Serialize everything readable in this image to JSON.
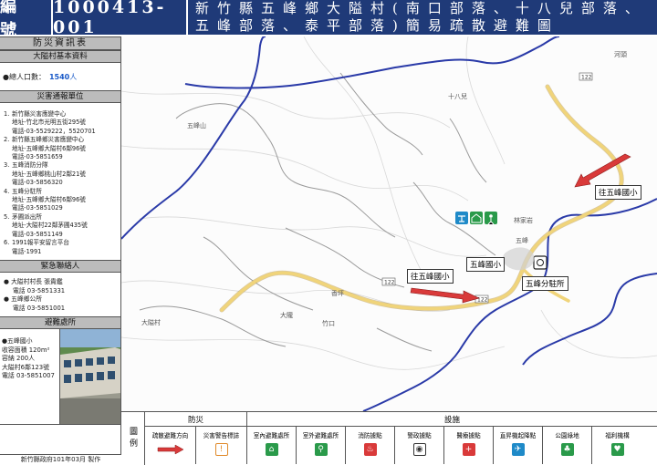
{
  "header": {
    "label": "編 號",
    "code": "1000413-001",
    "title_line1": "新竹縣五峰鄉大隘村(南口部落、十八兒部落、",
    "title_line2": "五峰部落、泰平部落)簡易疏散避難圖"
  },
  "sidebar": {
    "main_title": "防災資訊表",
    "basic_title": "大隘村基本資料",
    "pop_label": "●總人口數：",
    "pop_value": "1540",
    "pop_unit": "人",
    "units_title": "災害通報單位",
    "units": [
      {
        "num": "1.",
        "lines": [
          "新竹縣災害應變中心",
          "地址-竹北市光明五街295號",
          "電話-03-5529222，5520701"
        ]
      },
      {
        "num": "2.",
        "lines": [
          "新竹縣五峰鄉災害應變中心",
          "地址-五峰鄉大隘村6鄰96號",
          "電話-03-5851659"
        ]
      },
      {
        "num": "3.",
        "lines": [
          "五峰消防分隊",
          "地址-五峰鄉桃山村2鄰21號",
          "電話-03-5856320"
        ]
      },
      {
        "num": "4.",
        "lines": [
          "五峰分駐所",
          "地址-五峰鄉大隘村6鄰96號",
          "電話-03-5851029"
        ]
      },
      {
        "num": "5.",
        "lines": [
          "茅圃派出所",
          "地址-大隘村22鄰茅圃435號",
          "電話-03-5851149"
        ]
      },
      {
        "num": "6.",
        "lines": [
          "1991報平安留言平台",
          "電話-1991"
        ]
      }
    ],
    "contacts_title": "緊急聯絡人",
    "contacts": [
      {
        "lines": [
          "● 大隘村村長 張貴鑑",
          "電話 03-5851331"
        ]
      },
      {
        "lines": [
          "● 五峰鄉公所",
          "電話 03-5851001"
        ]
      }
    ],
    "shelter_title": "避難處所",
    "shelter_lines": [
      "●五峰國小",
      "收容面積 120m²",
      "容納 200人",
      "大隘村6鄰123號",
      "電話 03-5851007"
    ],
    "footer": "新竹縣政府101年03月 製作"
  },
  "map": {
    "labels": {
      "wufengshan": "五峰山",
      "shibaer": "十八兒",
      "linjia": "林家岩",
      "wufeng": "五峰",
      "xiangping": "香坪",
      "dalong": "大隴",
      "zhuokou": "竹口",
      "dayi": "大隘村",
      "heyuan": "河頭",
      "road": "122"
    },
    "box_wufeng_school": "五峰國小",
    "box_police": "五峰分駐所",
    "box_to_school_left": "往五峰國小",
    "box_to_school_right": "往五峰國小"
  },
  "legend": {
    "title": "圖例",
    "group_disaster": "防災",
    "group_facility": "設施",
    "items": [
      {
        "label": "疏散避難方向",
        "icon": "evacuation-arrow-icon",
        "color": "#d93a3a"
      },
      {
        "label": "災害警告標誌",
        "icon": "warning-sign-icon",
        "color": "#e08a2a"
      },
      {
        "label": "室內避難處所",
        "icon": "indoor-shelter-icon",
        "color": "#2a9a4a"
      },
      {
        "label": "室外避難處所",
        "icon": "outdoor-shelter-icon",
        "color": "#2a9a4a"
      },
      {
        "label": "消防據點",
        "icon": "fire-station-icon",
        "color": "#d93a3a"
      },
      {
        "label": "警政據點",
        "icon": "police-station-icon",
        "color": "#333333"
      },
      {
        "label": "醫療據點",
        "icon": "medical-cross-icon",
        "color": "#d93a3a"
      },
      {
        "label": "直昇機起降點",
        "icon": "helicopter-icon",
        "color": "#1f8ac8"
      },
      {
        "label": "公園綠地",
        "icon": "park-tree-icon",
        "color": "#2a9a4a"
      },
      {
        "label": "福利機構",
        "icon": "welfare-icon",
        "color": "#2a9a4a"
      }
    ]
  },
  "colors": {
    "header_bg": "#1f3a78",
    "river": "#2a3aa8",
    "highway": "#f0d47a",
    "evac_arrow": "#d93a3a"
  }
}
